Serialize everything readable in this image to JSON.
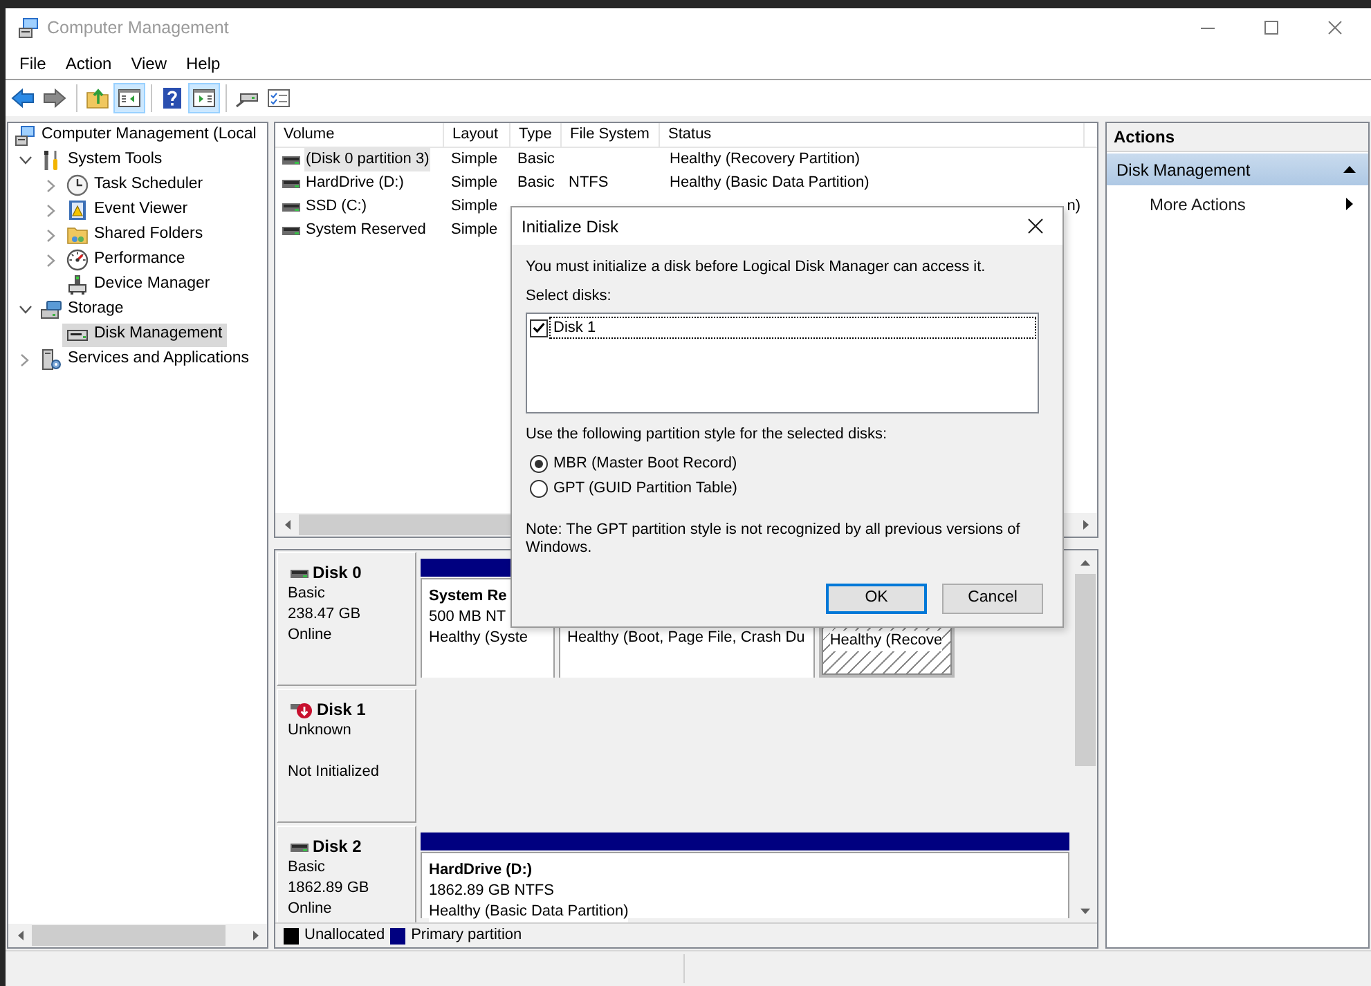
{
  "window": {
    "title": "Computer Management"
  },
  "menu": [
    "File",
    "Action",
    "View",
    "Help"
  ],
  "toolbar": {
    "groups": [
      [
        {
          "kind": "back",
          "pressed": false,
          "disabled": false
        },
        {
          "kind": "forward",
          "pressed": false,
          "disabled": true
        }
      ],
      [
        {
          "kind": "up-folder",
          "pressed": false,
          "disabled": false
        },
        {
          "kind": "tree-pane",
          "pressed": true,
          "disabled": false
        }
      ],
      [
        {
          "kind": "help",
          "pressed": false,
          "disabled": false
        },
        {
          "kind": "action-pane",
          "pressed": true,
          "disabled": false
        }
      ],
      [
        {
          "kind": "connect",
          "pressed": false,
          "disabled": false
        },
        {
          "kind": "properties",
          "pressed": false,
          "disabled": false
        }
      ]
    ]
  },
  "tree": [
    {
      "label": "Computer Management (Local",
      "kind": "computer",
      "selected": false,
      "children": [
        {
          "label": "System Tools",
          "kind": "tools",
          "expanded": true,
          "selected": false,
          "children": [
            {
              "label": "Task Scheduler",
              "kind": "clock",
              "expanded": false,
              "selected": false
            },
            {
              "label": "Event Viewer",
              "kind": "event-log",
              "expanded": false,
              "selected": false
            },
            {
              "label": "Shared Folders",
              "kind": "shared-folder",
              "expanded": false,
              "selected": false
            },
            {
              "label": "Performance",
              "kind": "gauge",
              "expanded": false,
              "selected": false
            },
            {
              "label": "Device Manager",
              "kind": "device",
              "selected": false
            }
          ]
        },
        {
          "label": "Storage",
          "kind": "storage",
          "expanded": true,
          "selected": false,
          "children": [
            {
              "label": "Disk Management",
              "kind": "disk",
              "selected": true
            }
          ]
        },
        {
          "label": "Services and Applications",
          "kind": "services",
          "expanded": false,
          "selected": false
        }
      ]
    }
  ],
  "volume_list": {
    "columns": [
      "Volume",
      "Layout",
      "Type",
      "File System",
      "Status"
    ],
    "rows": [
      {
        "volume": "(Disk 0 partition 3)",
        "layout": "Simple",
        "type": "Basic",
        "status": "Healthy (Recovery Partition)",
        "selected": true
      },
      {
        "volume": "HardDrive (D:)",
        "layout": "Simple",
        "type": "Basic",
        "file_system": "NTFS",
        "status": "Healthy (Basic Data Partition)",
        "selected": false
      },
      {
        "volume": "SSD (C:)",
        "layout": "Simple",
        "status_tail": "n)",
        "selected": false
      },
      {
        "volume": "System Reserved",
        "layout": "Simple",
        "selected": false
      }
    ]
  },
  "disks": [
    {
      "name": "Disk 0",
      "type": "Basic",
      "size": "238.47 GB",
      "state": "Online",
      "alert": false,
      "partitions": [
        {
          "name": "System Re",
          "detail": "500 MB NT",
          "status": "Healthy (Syste",
          "selected": false
        },
        {
          "status": "Healthy (Boot, Page File, Crash Du",
          "selected": false
        },
        {
          "status": "Healthy (Recove",
          "selected": true
        }
      ]
    },
    {
      "name": "Disk 1",
      "type": "Unknown",
      "state": "Not Initialized",
      "alert": true
    },
    {
      "name": "Disk 2",
      "type": "Basic",
      "size": "1862.89 GB",
      "state": "Online",
      "alert": false,
      "partitions": [
        {
          "name": "HardDrive  (D:)",
          "detail": "1862.89 GB NTFS",
          "status": "Healthy (Basic Data Partition)",
          "selected": false
        }
      ]
    }
  ],
  "legend": [
    {
      "label": "Unallocated",
      "color": "#000000"
    },
    {
      "label": "Primary partition",
      "color": "#000080"
    }
  ],
  "actions": {
    "title": "Actions",
    "sections": [
      {
        "label": "Disk Management",
        "expanded": true,
        "items": [
          {
            "label": "More Actions",
            "submenu": true
          }
        ]
      }
    ]
  },
  "dialog": {
    "title": "Initialize Disk",
    "message": "You must initialize a disk before Logical Disk Manager can access it.",
    "list_label": "Select disks:",
    "disks": [
      {
        "label": "Disk 1",
        "checked": true,
        "selected": true
      }
    ],
    "style_label": "Use the following partition style for the selected disks:",
    "styles": [
      {
        "label": "MBR (Master Boot Record)",
        "selected": true
      },
      {
        "label": "GPT (GUID Partition Table)",
        "selected": false
      }
    ],
    "note": "Note: The GPT partition style is not recognized by all previous versions of Windows.",
    "buttons": [
      {
        "label": "OK",
        "default": true
      },
      {
        "label": "Cancel",
        "default": false
      }
    ]
  }
}
